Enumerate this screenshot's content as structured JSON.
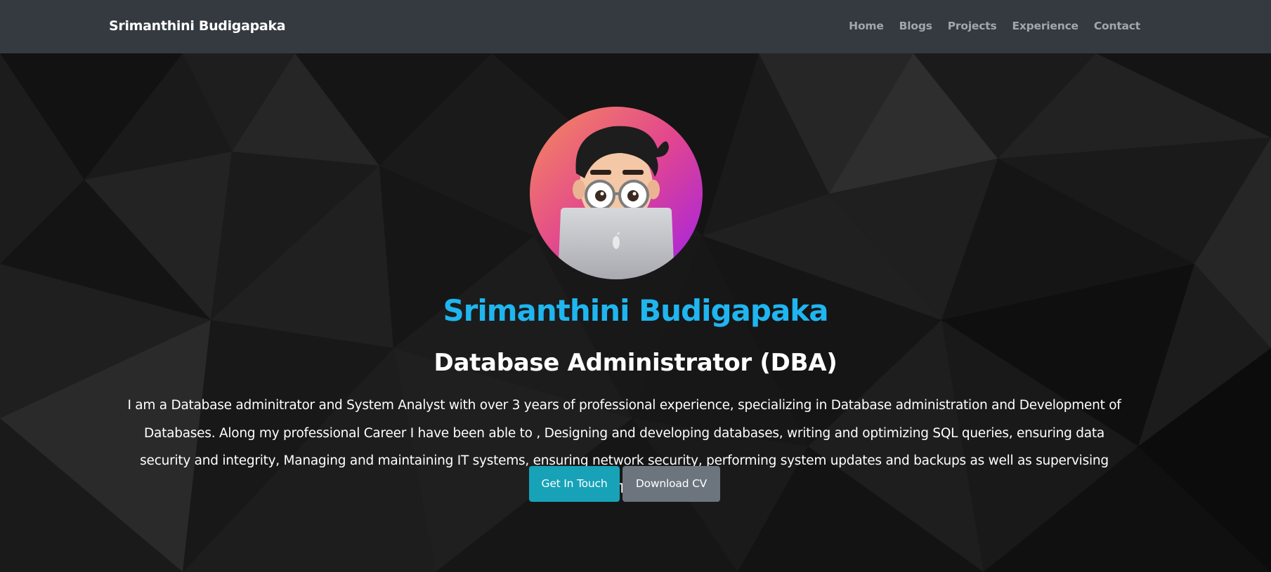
{
  "navbar": {
    "brand": "Srimanthini Budigapaka",
    "links": [
      {
        "label": "Home"
      },
      {
        "label": "Blogs"
      },
      {
        "label": "Projects"
      },
      {
        "label": "Experience"
      },
      {
        "label": "Contact"
      }
    ]
  },
  "hero": {
    "avatar_icon": "memoji-avatar-with-laptop",
    "name": "Srimanthini Budigapaka",
    "title": "Database Administrator (DBA)",
    "bio": "I am a Database adminitrator and System Analyst with over 3 years of professional experience, specializing in Database administration and Development of Databases. Along my professional Career I have been able to , Designing and developing databases, writing and optimizing SQL queries, ensuring data security and integrity, Managing and maintaining IT systems, ensuring network security, performing system updates and backups as well as supervising several IT projects.",
    "buttons": {
      "primary_label": "Get In Touch",
      "secondary_label": "Download CV"
    }
  },
  "colors": {
    "navbar_bg": "#343a40",
    "accent_name": "#1fb6f0",
    "btn_primary": "#17a2b8",
    "btn_secondary": "#6c757d"
  }
}
